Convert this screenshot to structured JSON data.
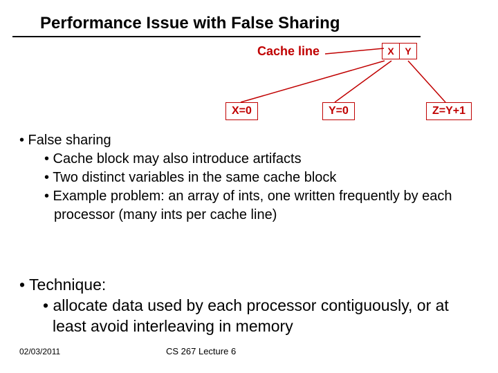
{
  "title": "Performance Issue with False Sharing",
  "cache_label": "Cache line",
  "xy": {
    "x": "X",
    "y": "Y"
  },
  "procs": {
    "x": "X=0",
    "y": "Y=0",
    "z": "Z=Y+1"
  },
  "section1": {
    "head": "• False sharing",
    "b1": "• Cache block may also introduce artifacts",
    "b2": "• Two distinct variables in the same cache block",
    "b3": "• Example problem: an array of ints, one written frequently by each processor (many ints per cache line)"
  },
  "section2": {
    "head": "• Technique:",
    "b1": "• allocate data used by each processor contiguously, or at least avoid interleaving in memory"
  },
  "footer": {
    "date": "02/03/2011",
    "lecture": "CS 267 Lecture 6"
  }
}
